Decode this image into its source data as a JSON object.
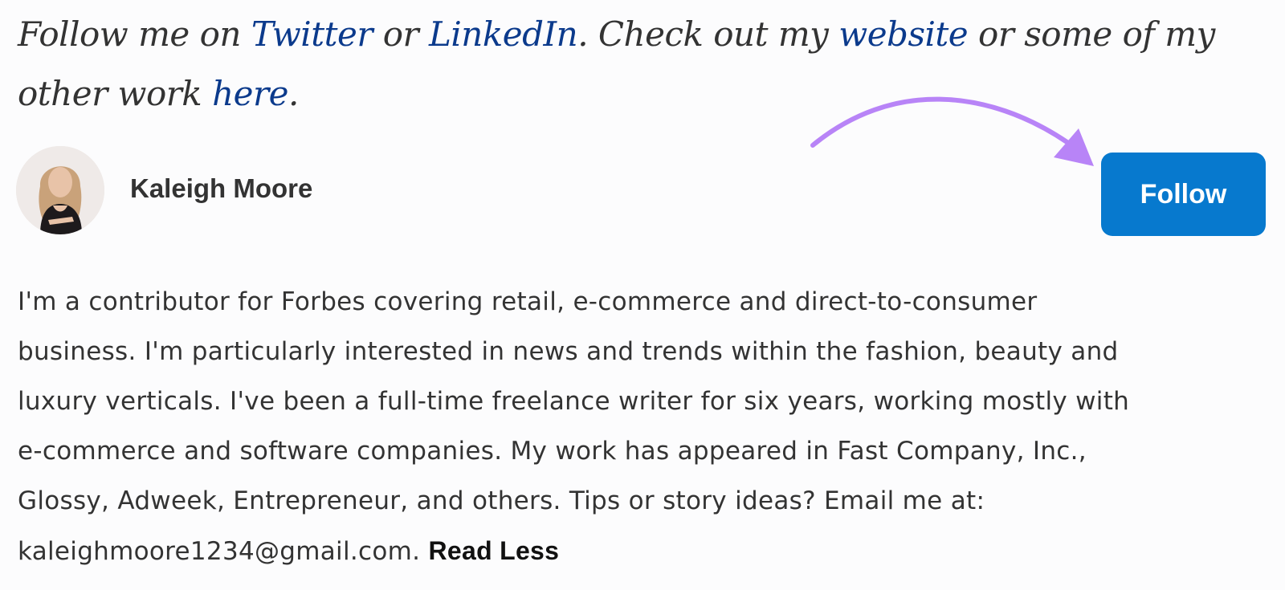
{
  "intro": {
    "prefix": "Follow me on ",
    "twitter_link": "Twitter",
    "or1": " or ",
    "linkedin_link": "LinkedIn",
    "mid": ". Check out my ",
    "website_link": "website",
    "mid2": " or some of my other work ",
    "here_link": "here",
    "end": "."
  },
  "author": {
    "name": "Kaleigh Moore",
    "avatar_icon": "author-avatar"
  },
  "follow_button": {
    "label": "Follow",
    "color": "#0779ce"
  },
  "annotation": {
    "arrow_color": "#b884f7",
    "arrow_icon": "curved-arrow-icon"
  },
  "bio": {
    "lines": [
      "I'm a contributor for Forbes covering retail, e-commerce and direct-to-consumer",
      "business. I'm particularly interested in news and trends within the fashion, beauty and",
      "luxury verticals. I've been a full-time freelance writer for six years, working mostly with",
      "e-commerce and software companies. My work has appeared in Fast Company, Inc.,",
      "Glossy, Adweek, Entrepreneur, and others. Tips or story ideas? Email me at:",
      "kaleighmoore1234@gmail.com. "
    ],
    "read_less": "Read Less"
  },
  "colors": {
    "link": "#0b3a8c",
    "text": "#333333",
    "background": "#fcfcfd"
  }
}
